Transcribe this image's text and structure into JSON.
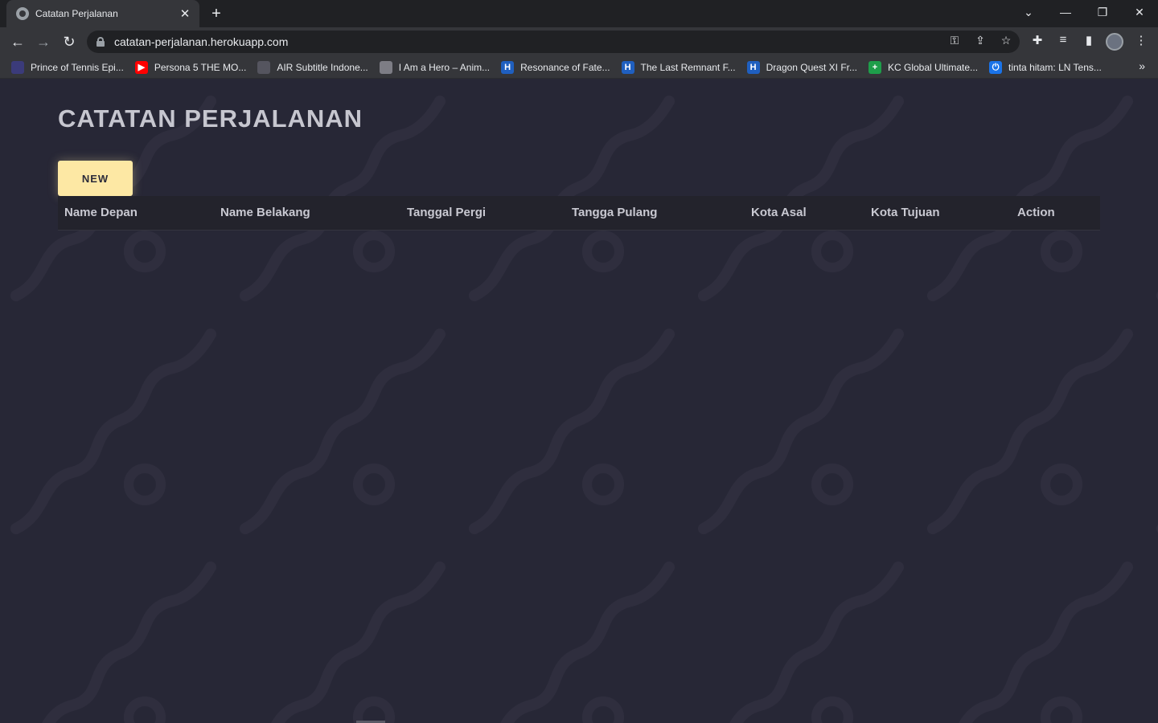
{
  "browser": {
    "tab_title": "Catatan Perjalanan",
    "tab_close": "✕",
    "new_tab": "+",
    "window_controls": {
      "minimize": "—",
      "restore": "❐",
      "close": "✕",
      "tab_search": "⌄"
    },
    "url": "catatan-perjalanan.herokuapp.com",
    "nav": {
      "back": "←",
      "forward": "→",
      "reload": "↻"
    },
    "omnibox_icons": {
      "key": "⚿",
      "share": "⇪",
      "star": "☆"
    },
    "toolbar_icons": {
      "extensions": "✚",
      "media": "≡",
      "sidepanel": "▮",
      "menu": "⋮"
    },
    "bookmarks": [
      {
        "label": "Prince of Tennis Epi...",
        "icon": "pot-icon",
        "color": "#3b3b7a",
        "glyph": ""
      },
      {
        "label": "Persona 5 THE MO...",
        "icon": "youtube-icon",
        "color": "#ff0000",
        "glyph": "▶"
      },
      {
        "label": "AIR Subtitle Indone...",
        "icon": "air-icon",
        "color": "#55555f",
        "glyph": ""
      },
      {
        "label": "I Am a Hero – Anim...",
        "icon": "globe-icon",
        "color": "#7d7d85",
        "glyph": ""
      },
      {
        "label": "Resonance of Fate...",
        "icon": "h-icon",
        "color": "#1f5fbf",
        "glyph": "H"
      },
      {
        "label": "The Last Remnant F...",
        "icon": "h-icon",
        "color": "#1f5fbf",
        "glyph": "H"
      },
      {
        "label": "Dragon Quest XI Fr...",
        "icon": "h-icon",
        "color": "#1f5fbf",
        "glyph": "H"
      },
      {
        "label": "KC Global Ultimate...",
        "icon": "plus-icon",
        "color": "#1e9e4a",
        "glyph": "+"
      },
      {
        "label": "tinta hitam: LN Tens...",
        "icon": "power-icon",
        "color": "#1a73e8",
        "glyph": "⏻"
      }
    ],
    "bookmarks_more": "»"
  },
  "page": {
    "title": "CATATAN PERJALANAN",
    "new_button": "NEW",
    "table_headers": [
      "Name Depan",
      "Name Belakang",
      "Tanggal Pergi",
      "Tangga Pulang",
      "Kota Asal",
      "Kota Tujuan",
      "Action"
    ],
    "colors": {
      "background": "#272736",
      "accent_button": "#fde8a4",
      "header_bg": "#23232c"
    }
  }
}
